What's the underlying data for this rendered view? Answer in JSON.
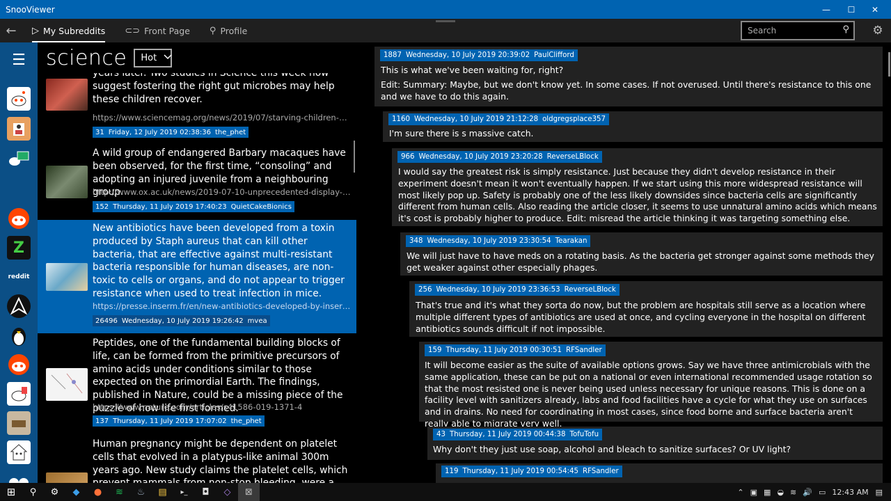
{
  "app": {
    "title": "SnooViewer"
  },
  "window_controls": {
    "minimize": "—",
    "maximize": "☐",
    "close": "✕"
  },
  "nav": {
    "back": "←",
    "tabs": [
      {
        "icon": "▷",
        "label": "My Subreddits"
      },
      {
        "icon": "⊂⊃",
        "label": "Front Page"
      },
      {
        "icon": "⚲",
        "label": "Profile"
      }
    ]
  },
  "search": {
    "placeholder": "Search",
    "icon": "⚲"
  },
  "settings_icon": "⚙",
  "sidebar": {
    "menu_icon": "☰"
  },
  "subreddit": {
    "name": "science",
    "sort": "Hot"
  },
  "posts": [
    {
      "title": "years later. Two studies in Science this week now suggest fostering the right gut microbes may help these children recover.",
      "url": "https://www.sciencemag.org/news/2019/07/starving-children-often-recover-only-part-way-heres-how-gut-microbes-could-help",
      "score": "31",
      "date": "Friday, 12 July 2019 02:38:36",
      "author": "the_phet"
    },
    {
      "title": "A wild group of endangered Barbary macaques have been observed, for the first time, “consoling” and adopting an injured juvenile from a neighbouring group.",
      "url": "http://www.ox.ac.uk/news/2019-07-10-unprecedented-display-concern-wild-monkeys",
      "score": "152",
      "date": "Thursday, 11 July 2019 17:40:23",
      "author": "QuietCakeBionics"
    },
    {
      "title": "New antibiotics have been developed from a toxin produced by Staph aureus that can kill other bacteria, that are effective against multi-resistant bacteria responsible for human diseases, are non-toxic to cells or organs, and do not appear to trigger resistance when used to treat infection in mice.",
      "url": "https://presse.inserm.fr/en/new-antibiotics-developed-by-inserm-and-the-university-of-rennes",
      "score": "26496",
      "date": "Wednesday, 10 July 2019 19:26:42",
      "author": "mvea"
    },
    {
      "title": "Peptides, one of the fundamental building blocks of life, can be formed from the primitive precursors of amino acids under conditions similar to those expected on the primordial Earth. The findings, published in Nature, could be a missing piece of the puzzle of how life first formed.",
      "url": "https://www.nature.com/articles/s41586-019-1371-4",
      "score": "137",
      "date": "Thursday, 11 July 2019 17:07:02",
      "author": "the_phet"
    },
    {
      "title": "Human pregnancy might be dependent on platelet cells that evolved in a platypus-like animal 300m years ago. New study claims the platelet cells, which prevent mammals from non-stop bleeding, were a prerequisite",
      "url": "",
      "score": "",
      "date": "",
      "author": ""
    }
  ],
  "comments": [
    {
      "score": "1887",
      "date": "Wednesday, 10 July 2019 20:39:02",
      "author": "PaulClifford",
      "lines": [
        "This is what we've been waiting for, right?",
        "Edit: Summary: Maybe, but we don't know yet. In some cases. If not overused. Until there's resistance to this one and we have to do this again."
      ]
    },
    {
      "score": "1160",
      "date": "Wednesday, 10 July 2019 21:12:28",
      "author": "oldgregsplace357",
      "lines": [
        "I'm sure there is s massive catch."
      ]
    },
    {
      "score": "966",
      "date": "Wednesday, 10 July 2019 23:20:28",
      "author": "ReverseLBlock",
      "lines": [
        "I would say the greatest risk is simply resistance. Just because they didn't develop resistance in their experiment doesn't mean it won't eventually happen. If we start using this more widespread resistance will most likely pop up. Safety is probably one of the less likely downsides since bacteria cells are significantly different from human cells. Also reading the article closer, it seems to use unnatural amino acids which means it's cost is probably higher to produce. Edit: misread the article thinking it was targeting something else."
      ]
    },
    {
      "score": "348",
      "date": "Wednesday, 10 July 2019 23:30:54",
      "author": "Tearakan",
      "lines": [
        "We will just have to have meds on a rotating basis. As the bacteria get stronger against some methods they get weaker against other especially phages."
      ]
    },
    {
      "score": "256",
      "date": "Wednesday, 10 July 2019 23:36:53",
      "author": "ReverseLBlock",
      "lines": [
        "That's true and it's what they sorta do now, but the problem are hospitals still serve as a location where multiple different types of antibiotics are used at once, and cycling everyone in the hospital on different antibiotics sounds difficult if not impossible."
      ]
    },
    {
      "score": "159",
      "date": "Thursday, 11 July 2019 00:30:51",
      "author": "RFSandler",
      "lines": [
        "It will become easier as the suite of available options grows. Say we have three antimicrobials with the same application, these can be put on a national or even international recommended usage rotation so that the most resisted one is never being used unless necessary for unique reasons. This is done on a facility level with sanitizers already, labs and food facilities have a cycle for what they use on surfaces and in drains. No need for coordinating in most cases, since food borne and surface bacteria aren't really able to migrate very well."
      ]
    },
    {
      "score": "43",
      "date": "Thursday, 11 July 2019 00:44:38",
      "author": "TofuTofu",
      "lines": [
        "Why don't they just use soap, alcohol and bleach to sanitize surfaces? Or UV light?"
      ]
    },
    {
      "score": "119",
      "date": "Thursday, 11 July 2019 00:54:45",
      "author": "RFSandler",
      "lines": [
        ""
      ]
    }
  ],
  "taskbar": {
    "start": "⊞",
    "search": "⚲",
    "apps": [
      "⚙",
      "◆",
      "●",
      "≋",
      "♨",
      "▤",
      "▸_",
      "◘",
      "◇",
      "⊠"
    ],
    "tray_icons": [
      "⌃",
      "▣",
      "▦",
      "◒",
      "≋",
      "🔊",
      "▭"
    ],
    "time": "12:43 AM",
    "notify": "▤"
  }
}
